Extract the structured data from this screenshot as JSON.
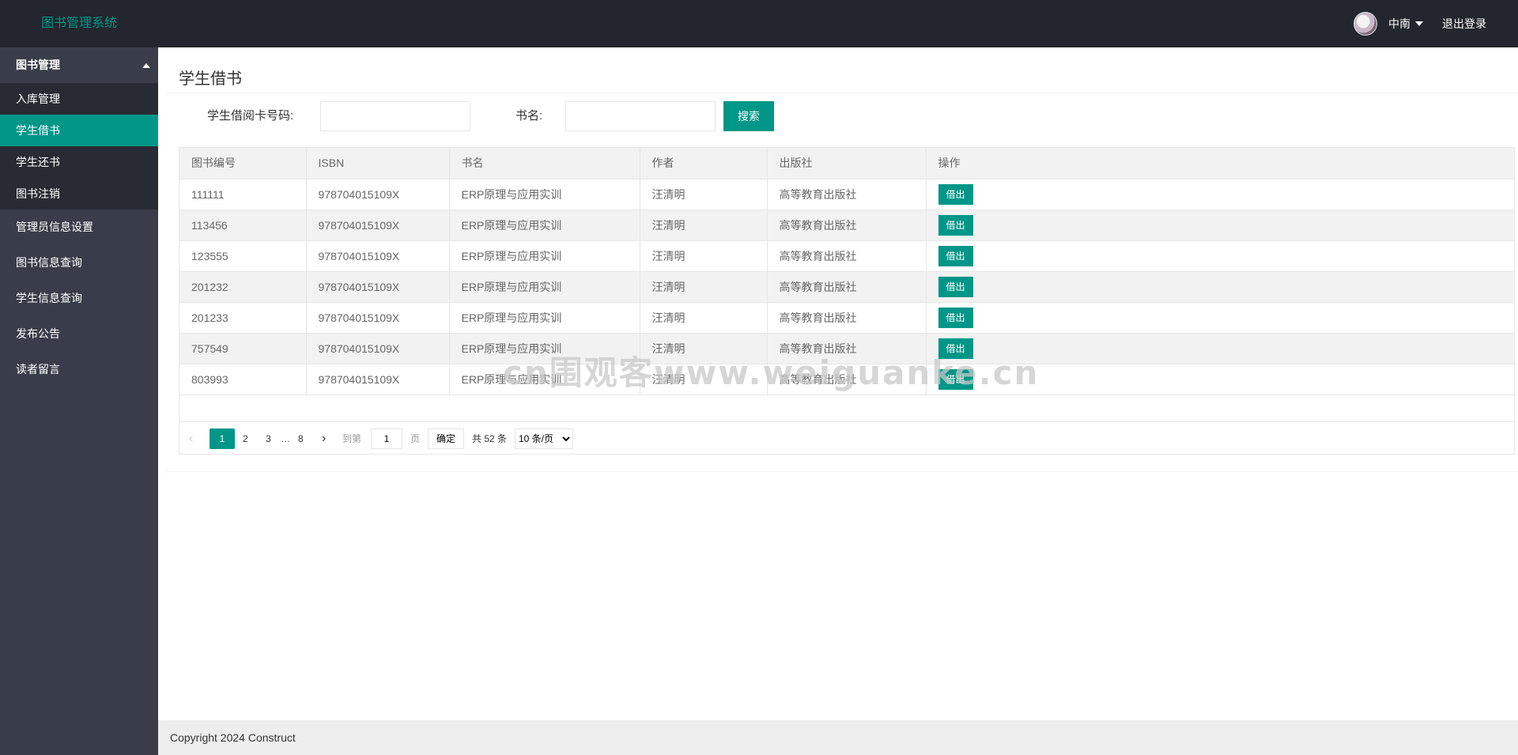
{
  "header": {
    "logo": "图书管理系统",
    "user_name": "中南",
    "logout": "退出登录"
  },
  "sidebar": {
    "group": {
      "label": "图书管理",
      "children": [
        "入库管理",
        "学生借书",
        "学生还书",
        "图书注销"
      ]
    },
    "items": [
      "管理员信息设置",
      "图书信息查询",
      "学生信息查询",
      "发布公告",
      "读者留言"
    ]
  },
  "main": {
    "title": "学生借书",
    "search": {
      "card_label": "学生借阅卡号码:",
      "card_value": "",
      "book_label": "书名:",
      "book_value": "",
      "button": "搜索"
    },
    "table": {
      "columns": [
        "图书编号",
        "ISBN",
        "书名",
        "作者",
        "出版社",
        "操作"
      ],
      "rows": [
        [
          "111111",
          "978704015109X",
          "ERP原理与应用实训",
          "汪清明",
          "高等教育出版社",
          "借出"
        ],
        [
          "113456",
          "978704015109X",
          "ERP原理与应用实训",
          "汪清明",
          "高等教育出版社",
          "借出"
        ],
        [
          "123555",
          "978704015109X",
          "ERP原理与应用实训",
          "汪清明",
          "高等教育出版社",
          "借出"
        ],
        [
          "201232",
          "978704015109X",
          "ERP原理与应用实训",
          "汪清明",
          "高等教育出版社",
          "借出"
        ],
        [
          "201233",
          "978704015109X",
          "ERP原理与应用实训",
          "汪清明",
          "高等教育出版社",
          "借出"
        ],
        [
          "757549",
          "978704015109X",
          "ERP原理与应用实训",
          "汪清明",
          "高等教育出版社",
          "借出"
        ],
        [
          "803993",
          "978704015109X",
          "ERP原理与应用实训",
          "汪清明",
          "高等教育出版社",
          "借出"
        ]
      ]
    },
    "pager": {
      "prev": "‹",
      "pages": [
        "1",
        "2",
        "3",
        "…",
        "8"
      ],
      "next": "›",
      "goto_label": "到第",
      "goto_value": "1",
      "page_unit": "页",
      "confirm": "确定",
      "total": "共 52 条",
      "page_size": "10 条/页"
    }
  },
  "watermark": "cn围观客www.weiguanke.cn",
  "footer": {
    "copyright": "Copyright 2024 Construct"
  },
  "colors": {
    "accent": "#009688",
    "header_bg": "#23262e",
    "sidebar_bg": "#393d49",
    "sidebar_child_bg": "#282b33"
  }
}
